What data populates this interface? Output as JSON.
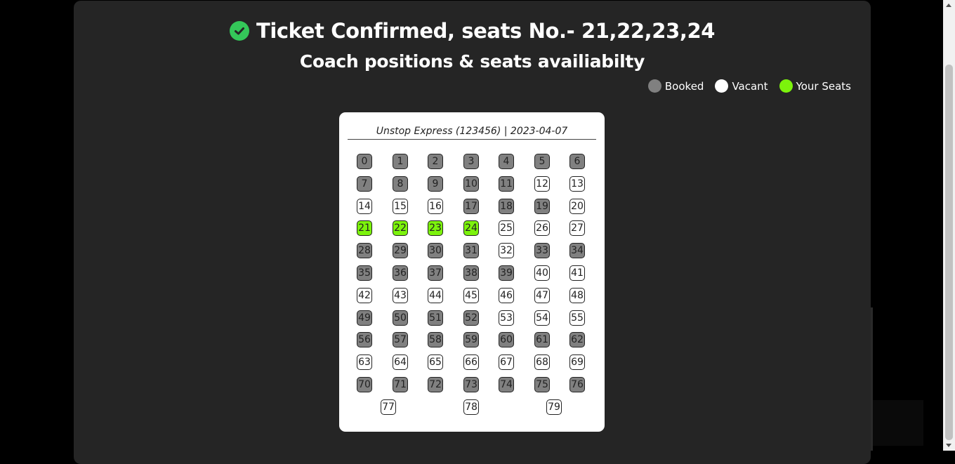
{
  "header": {
    "icon": "check-circle-icon",
    "confirmation_text": "Ticket Confirmed, seats No.- 21,22,23,24",
    "subtitle": "Coach positions & seats availiabilty"
  },
  "legend": {
    "booked": "Booked",
    "vacant": "Vacant",
    "your_seats": "Your Seats"
  },
  "colors": {
    "booked": "#808080",
    "vacant": "#ffffff",
    "your_seats": "#7cf30c",
    "confirm_icon": "#34c759",
    "panel": "#252525"
  },
  "train_info": "Unstop Express (123456) | 2023-04-07",
  "seats": [
    {
      "label": "0",
      "status": "booked"
    },
    {
      "label": "1",
      "status": "booked"
    },
    {
      "label": "2",
      "status": "booked"
    },
    {
      "label": "3",
      "status": "booked"
    },
    {
      "label": "4",
      "status": "booked"
    },
    {
      "label": "5",
      "status": "booked"
    },
    {
      "label": "6",
      "status": "booked"
    },
    {
      "label": "7",
      "status": "booked"
    },
    {
      "label": "8",
      "status": "booked"
    },
    {
      "label": "9",
      "status": "booked"
    },
    {
      "label": "10",
      "status": "booked"
    },
    {
      "label": "11",
      "status": "booked"
    },
    {
      "label": "12",
      "status": "vacant"
    },
    {
      "label": "13",
      "status": "vacant"
    },
    {
      "label": "14",
      "status": "vacant"
    },
    {
      "label": "15",
      "status": "vacant"
    },
    {
      "label": "16",
      "status": "vacant"
    },
    {
      "label": "17",
      "status": "booked"
    },
    {
      "label": "18",
      "status": "booked"
    },
    {
      "label": "19",
      "status": "booked"
    },
    {
      "label": "20",
      "status": "vacant"
    },
    {
      "label": "21",
      "status": "mine"
    },
    {
      "label": "22",
      "status": "mine"
    },
    {
      "label": "23",
      "status": "mine"
    },
    {
      "label": "24",
      "status": "mine"
    },
    {
      "label": "25",
      "status": "vacant"
    },
    {
      "label": "26",
      "status": "vacant"
    },
    {
      "label": "27",
      "status": "vacant"
    },
    {
      "label": "28",
      "status": "booked"
    },
    {
      "label": "29",
      "status": "booked"
    },
    {
      "label": "30",
      "status": "booked"
    },
    {
      "label": "31",
      "status": "booked"
    },
    {
      "label": "32",
      "status": "vacant"
    },
    {
      "label": "33",
      "status": "booked"
    },
    {
      "label": "34",
      "status": "booked"
    },
    {
      "label": "35",
      "status": "booked"
    },
    {
      "label": "36",
      "status": "booked"
    },
    {
      "label": "37",
      "status": "booked"
    },
    {
      "label": "38",
      "status": "booked"
    },
    {
      "label": "39",
      "status": "booked"
    },
    {
      "label": "40",
      "status": "vacant"
    },
    {
      "label": "41",
      "status": "vacant"
    },
    {
      "label": "42",
      "status": "vacant"
    },
    {
      "label": "43",
      "status": "vacant"
    },
    {
      "label": "44",
      "status": "vacant"
    },
    {
      "label": "45",
      "status": "vacant"
    },
    {
      "label": "46",
      "status": "vacant"
    },
    {
      "label": "47",
      "status": "vacant"
    },
    {
      "label": "48",
      "status": "vacant"
    },
    {
      "label": "49",
      "status": "booked"
    },
    {
      "label": "50",
      "status": "booked"
    },
    {
      "label": "51",
      "status": "booked"
    },
    {
      "label": "52",
      "status": "booked"
    },
    {
      "label": "53",
      "status": "vacant"
    },
    {
      "label": "54",
      "status": "vacant"
    },
    {
      "label": "55",
      "status": "vacant"
    },
    {
      "label": "56",
      "status": "booked"
    },
    {
      "label": "57",
      "status": "booked"
    },
    {
      "label": "58",
      "status": "booked"
    },
    {
      "label": "59",
      "status": "booked"
    },
    {
      "label": "60",
      "status": "booked"
    },
    {
      "label": "61",
      "status": "booked"
    },
    {
      "label": "62",
      "status": "booked"
    },
    {
      "label": "63",
      "status": "vacant"
    },
    {
      "label": "64",
      "status": "vacant"
    },
    {
      "label": "65",
      "status": "vacant"
    },
    {
      "label": "66",
      "status": "vacant"
    },
    {
      "label": "67",
      "status": "vacant"
    },
    {
      "label": "68",
      "status": "vacant"
    },
    {
      "label": "69",
      "status": "vacant"
    },
    {
      "label": "70",
      "status": "booked"
    },
    {
      "label": "71",
      "status": "booked"
    },
    {
      "label": "72",
      "status": "booked"
    },
    {
      "label": "73",
      "status": "booked"
    },
    {
      "label": "74",
      "status": "booked"
    },
    {
      "label": "75",
      "status": "booked"
    },
    {
      "label": "76",
      "status": "booked"
    },
    {
      "label": "77",
      "status": "vacant"
    },
    {
      "label": "78",
      "status": "vacant"
    },
    {
      "label": "79",
      "status": "vacant"
    }
  ]
}
